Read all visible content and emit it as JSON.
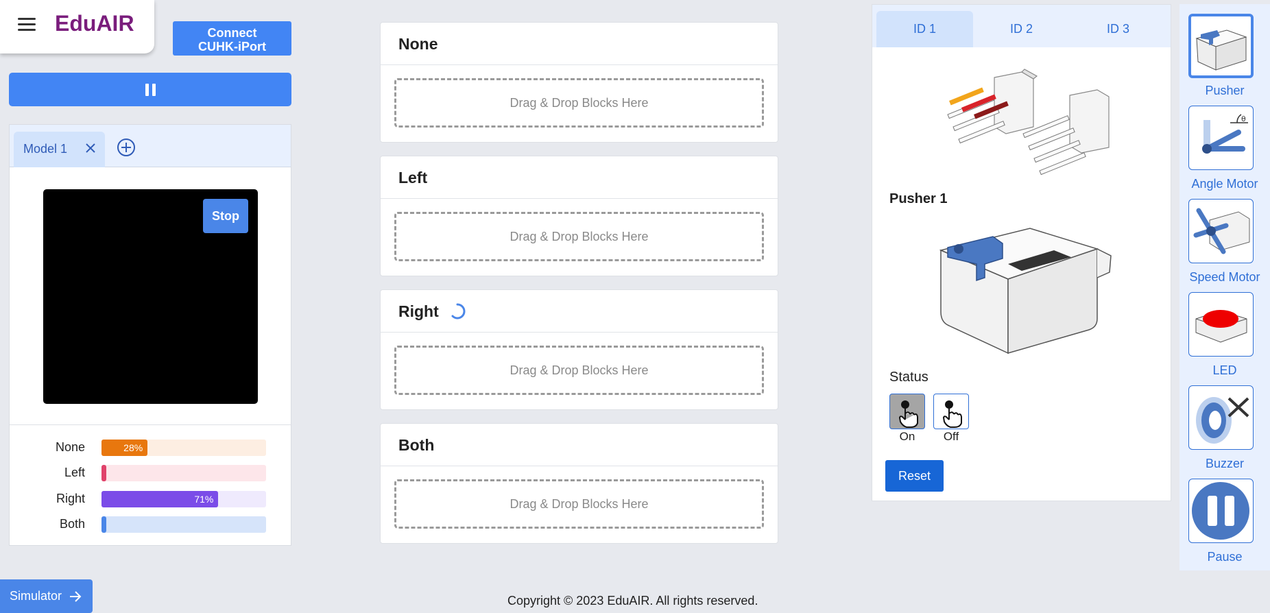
{
  "brand": {
    "title": "EduAIR"
  },
  "header": {
    "connect_label_line1": "Connect",
    "connect_label_line2": "CUHK-iPort"
  },
  "model": {
    "tab_label": "Model 1",
    "stop_label": "Stop",
    "predictions": [
      {
        "label": "None",
        "percent": 28,
        "value_text": "28%",
        "fill": "#e8770e",
        "track": "#fdeee2"
      },
      {
        "label": "Left",
        "percent": 1,
        "value_text": "",
        "fill": "#e0436b",
        "track": "#fde6ea"
      },
      {
        "label": "Right",
        "percent": 71,
        "value_text": "71%",
        "fill": "#7b4ce8",
        "track": "#efeafd"
      },
      {
        "label": "Both",
        "percent": 0,
        "value_text": "",
        "fill": "#4a86e8",
        "track": "#d6e4fa"
      }
    ]
  },
  "blocks": [
    {
      "title": "None",
      "drop_text": "Drag & Drop Blocks Here",
      "loading": false
    },
    {
      "title": "Left",
      "drop_text": "Drag & Drop Blocks Here",
      "loading": false
    },
    {
      "title": "Right",
      "drop_text": "Drag & Drop Blocks Here",
      "loading": true
    },
    {
      "title": "Both",
      "drop_text": "Drag & Drop Blocks Here",
      "loading": false
    }
  ],
  "device": {
    "tabs": [
      "ID 1",
      "ID 2",
      "ID 3"
    ],
    "active_tab": "ID 1",
    "name": "Pusher 1",
    "status_label": "Status",
    "on_label": "On",
    "off_label": "Off",
    "reset_label": "Reset"
  },
  "palette": [
    {
      "label": "Pusher",
      "icon": "pusher-icon",
      "selected": true
    },
    {
      "label": "Angle Motor",
      "icon": "angle-motor-icon",
      "selected": false
    },
    {
      "label": "Speed Motor",
      "icon": "speed-motor-icon",
      "selected": false
    },
    {
      "label": "LED",
      "icon": "led-icon",
      "selected": false
    },
    {
      "label": "Buzzer",
      "icon": "buzzer-icon",
      "selected": false
    },
    {
      "label": "Pause",
      "icon": "pause-icon",
      "selected": false
    }
  ],
  "simulator": {
    "label": "Simulator"
  },
  "footer": {
    "copyright": "Copyright © 2023 EduAIR. All rights reserved."
  },
  "colors": {
    "primary": "#4285f4",
    "brand": "#7a1d7c",
    "link": "#2f6fd6"
  }
}
